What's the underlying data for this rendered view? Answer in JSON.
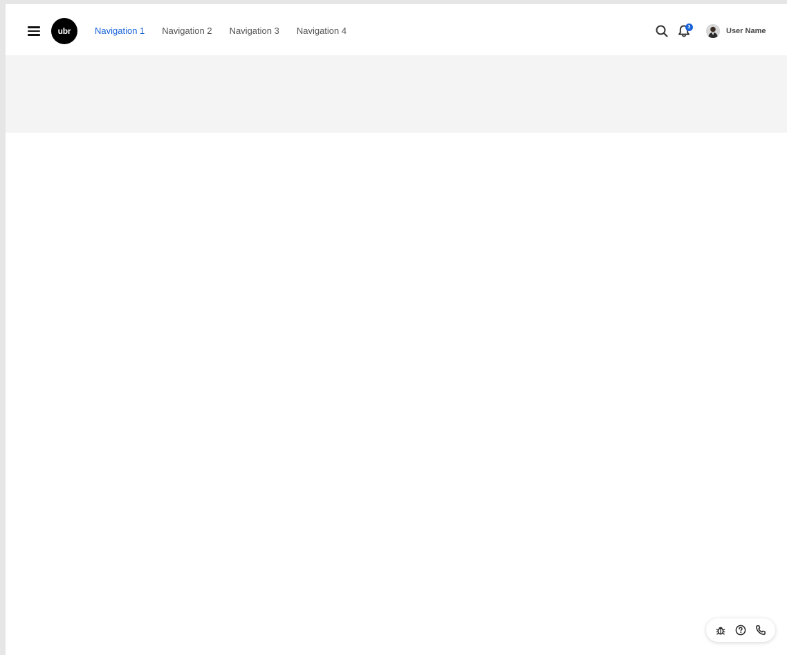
{
  "header": {
    "logo_text": "ubr",
    "nav": [
      {
        "label": "Navigation 1",
        "active": true
      },
      {
        "label": "Navigation 2",
        "active": false
      },
      {
        "label": "Navigation 3",
        "active": false
      },
      {
        "label": "Navigation 4",
        "active": false
      }
    ],
    "notifications_count": "3",
    "user_name": "User Name",
    "icons": {
      "menu": "hamburger-menu-icon",
      "search": "search-icon",
      "notifications": "bell-icon",
      "avatar": "user-avatar"
    }
  },
  "floating_tools": {
    "icons": [
      "bug-icon",
      "help-circle-icon",
      "phone-icon"
    ]
  },
  "colors": {
    "accent": "#1a63d8",
    "banner_bg": "#f4f4f4",
    "page_bg": "#ffffff",
    "outer_bg": "#e6e6e6"
  }
}
